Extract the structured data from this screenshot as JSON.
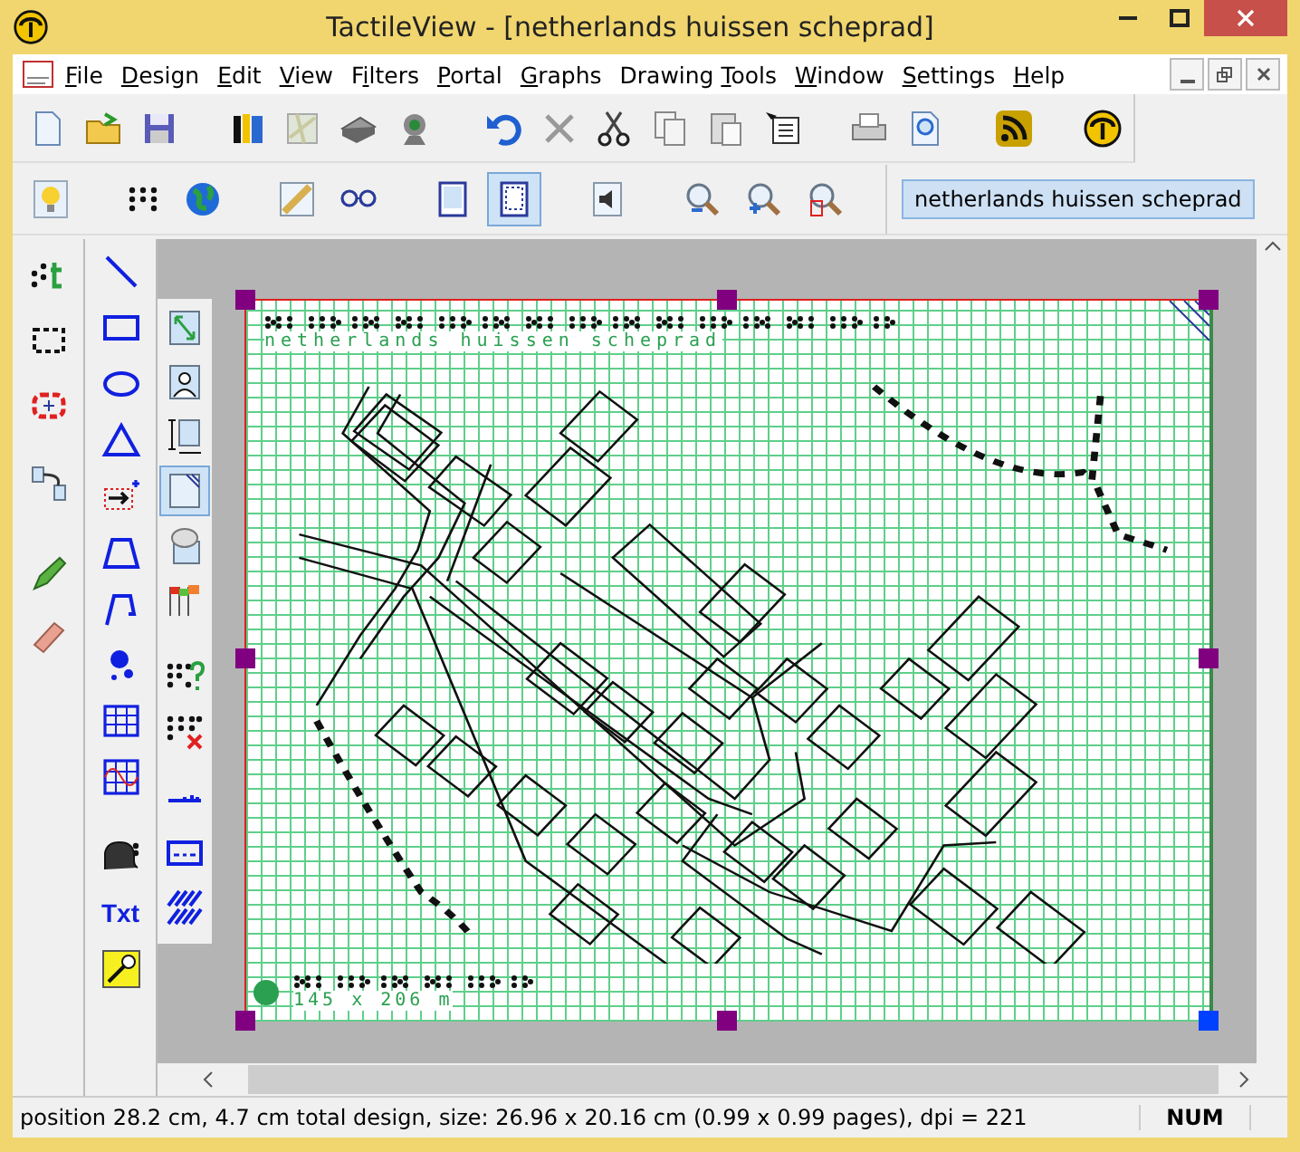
{
  "window": {
    "title": "TactileView - [netherlands huissen scheprad]"
  },
  "menu": [
    {
      "key": "F",
      "post": "ile"
    },
    {
      "key": "D",
      "post": "esign"
    },
    {
      "key": "E",
      "post": "dit"
    },
    {
      "key": "V",
      "post": "iew"
    },
    {
      "pre": "F",
      "key": "i",
      "post": "lters"
    },
    {
      "key": "P",
      "post": "ortal"
    },
    {
      "key": "G",
      "post": "raphs"
    },
    {
      "pre": "Drawing ",
      "key": "T",
      "post": "ools"
    },
    {
      "key": "W",
      "post": "indow"
    },
    {
      "key": "S",
      "post": "ettings"
    },
    {
      "key": "H",
      "post": "elp"
    }
  ],
  "toolbar_main": [
    {
      "selected": false
    },
    {
      "selected": false
    },
    {
      "selected": false
    },
    {
      "selected": false
    },
    {
      "selected": false
    },
    {
      "selected": false
    },
    {
      "selected": false
    },
    {
      "selected": false
    },
    {
      "selected": false
    },
    {
      "selected": false
    },
    {
      "selected": false
    },
    {
      "selected": false
    },
    {
      "selected": false
    },
    {
      "selected": false
    },
    {
      "selected": false
    },
    {
      "selected": false
    },
    {
      "selected": false
    }
  ],
  "toolbar_view": [
    {
      "selected": false
    },
    {
      "selected": false
    },
    {
      "selected": false
    },
    {
      "selected": false
    },
    {
      "selected": false
    },
    {
      "selected": false
    },
    {
      "selected": true
    },
    {
      "selected": false
    },
    {
      "selected": false
    },
    {
      "selected": false
    },
    {
      "selected": false
    }
  ],
  "design_title": "netherlands huissen scheprad",
  "tools_left": [
    {
      "selected": false
    },
    {
      "selected": false
    },
    {
      "selected": false
    },
    {
      "selected": false
    },
    {
      "selected": false
    },
    {
      "selected": false
    }
  ],
  "tools_shapes": [
    {
      "selected": false
    },
    {
      "selected": false
    },
    {
      "selected": false
    },
    {
      "selected": false
    },
    {
      "selected": false
    },
    {
      "selected": false
    },
    {
      "selected": false
    },
    {
      "selected": false
    },
    {
      "selected": false
    },
    {
      "selected": false
    },
    {
      "selected": false
    },
    {
      "selected": false,
      "label": "Txt"
    },
    {
      "selected": false
    }
  ],
  "tools_page": [
    {
      "selected": false
    },
    {
      "selected": false
    },
    {
      "selected": false
    },
    {
      "selected": true
    },
    {
      "selected": false
    },
    {
      "selected": false
    },
    {
      "selected": false
    },
    {
      "selected": false
    },
    {
      "selected": false
    },
    {
      "selected": false
    },
    {
      "selected": false
    }
  ],
  "canvas": {
    "title_text": "netherlands huissen scheprad",
    "scale_text": "145 x 206 m"
  },
  "status_bar": {
    "message": "position 28.2 cm, 4.7 cm total design, size: 26.96 x 20.16 cm (0.99 x 0.99 pages), dpi = 221",
    "indicator": "NUM"
  }
}
